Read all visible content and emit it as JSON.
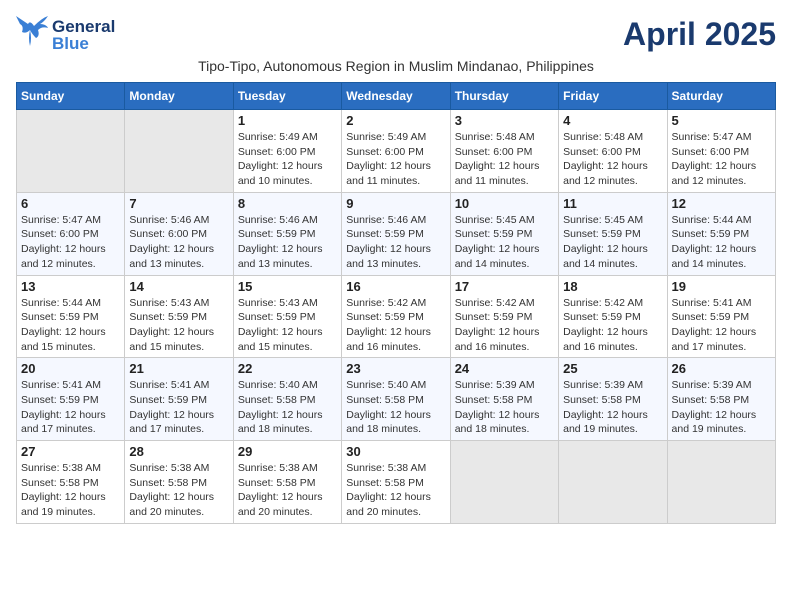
{
  "header": {
    "logo": {
      "general": "General",
      "blue": "Blue"
    },
    "title": "April 2025",
    "subtitle": "Tipo-Tipo, Autonomous Region in Muslim Mindanao, Philippines"
  },
  "weekdays": [
    "Sunday",
    "Monday",
    "Tuesday",
    "Wednesday",
    "Thursday",
    "Friday",
    "Saturday"
  ],
  "weeks": [
    [
      {
        "day": "",
        "info": ""
      },
      {
        "day": "",
        "info": ""
      },
      {
        "day": "1",
        "info": "Sunrise: 5:49 AM\nSunset: 6:00 PM\nDaylight: 12 hours\nand 10 minutes."
      },
      {
        "day": "2",
        "info": "Sunrise: 5:49 AM\nSunset: 6:00 PM\nDaylight: 12 hours\nand 11 minutes."
      },
      {
        "day": "3",
        "info": "Sunrise: 5:48 AM\nSunset: 6:00 PM\nDaylight: 12 hours\nand 11 minutes."
      },
      {
        "day": "4",
        "info": "Sunrise: 5:48 AM\nSunset: 6:00 PM\nDaylight: 12 hours\nand 12 minutes."
      },
      {
        "day": "5",
        "info": "Sunrise: 5:47 AM\nSunset: 6:00 PM\nDaylight: 12 hours\nand 12 minutes."
      }
    ],
    [
      {
        "day": "6",
        "info": "Sunrise: 5:47 AM\nSunset: 6:00 PM\nDaylight: 12 hours\nand 12 minutes."
      },
      {
        "day": "7",
        "info": "Sunrise: 5:46 AM\nSunset: 6:00 PM\nDaylight: 12 hours\nand 13 minutes."
      },
      {
        "day": "8",
        "info": "Sunrise: 5:46 AM\nSunset: 5:59 PM\nDaylight: 12 hours\nand 13 minutes."
      },
      {
        "day": "9",
        "info": "Sunrise: 5:46 AM\nSunset: 5:59 PM\nDaylight: 12 hours\nand 13 minutes."
      },
      {
        "day": "10",
        "info": "Sunrise: 5:45 AM\nSunset: 5:59 PM\nDaylight: 12 hours\nand 14 minutes."
      },
      {
        "day": "11",
        "info": "Sunrise: 5:45 AM\nSunset: 5:59 PM\nDaylight: 12 hours\nand 14 minutes."
      },
      {
        "day": "12",
        "info": "Sunrise: 5:44 AM\nSunset: 5:59 PM\nDaylight: 12 hours\nand 14 minutes."
      }
    ],
    [
      {
        "day": "13",
        "info": "Sunrise: 5:44 AM\nSunset: 5:59 PM\nDaylight: 12 hours\nand 15 minutes."
      },
      {
        "day": "14",
        "info": "Sunrise: 5:43 AM\nSunset: 5:59 PM\nDaylight: 12 hours\nand 15 minutes."
      },
      {
        "day": "15",
        "info": "Sunrise: 5:43 AM\nSunset: 5:59 PM\nDaylight: 12 hours\nand 15 minutes."
      },
      {
        "day": "16",
        "info": "Sunrise: 5:42 AM\nSunset: 5:59 PM\nDaylight: 12 hours\nand 16 minutes."
      },
      {
        "day": "17",
        "info": "Sunrise: 5:42 AM\nSunset: 5:59 PM\nDaylight: 12 hours\nand 16 minutes."
      },
      {
        "day": "18",
        "info": "Sunrise: 5:42 AM\nSunset: 5:59 PM\nDaylight: 12 hours\nand 16 minutes."
      },
      {
        "day": "19",
        "info": "Sunrise: 5:41 AM\nSunset: 5:59 PM\nDaylight: 12 hours\nand 17 minutes."
      }
    ],
    [
      {
        "day": "20",
        "info": "Sunrise: 5:41 AM\nSunset: 5:59 PM\nDaylight: 12 hours\nand 17 minutes."
      },
      {
        "day": "21",
        "info": "Sunrise: 5:41 AM\nSunset: 5:59 PM\nDaylight: 12 hours\nand 17 minutes."
      },
      {
        "day": "22",
        "info": "Sunrise: 5:40 AM\nSunset: 5:58 PM\nDaylight: 12 hours\nand 18 minutes."
      },
      {
        "day": "23",
        "info": "Sunrise: 5:40 AM\nSunset: 5:58 PM\nDaylight: 12 hours\nand 18 minutes."
      },
      {
        "day": "24",
        "info": "Sunrise: 5:39 AM\nSunset: 5:58 PM\nDaylight: 12 hours\nand 18 minutes."
      },
      {
        "day": "25",
        "info": "Sunrise: 5:39 AM\nSunset: 5:58 PM\nDaylight: 12 hours\nand 19 minutes."
      },
      {
        "day": "26",
        "info": "Sunrise: 5:39 AM\nSunset: 5:58 PM\nDaylight: 12 hours\nand 19 minutes."
      }
    ],
    [
      {
        "day": "27",
        "info": "Sunrise: 5:38 AM\nSunset: 5:58 PM\nDaylight: 12 hours\nand 19 minutes."
      },
      {
        "day": "28",
        "info": "Sunrise: 5:38 AM\nSunset: 5:58 PM\nDaylight: 12 hours\nand 20 minutes."
      },
      {
        "day": "29",
        "info": "Sunrise: 5:38 AM\nSunset: 5:58 PM\nDaylight: 12 hours\nand 20 minutes."
      },
      {
        "day": "30",
        "info": "Sunrise: 5:38 AM\nSunset: 5:58 PM\nDaylight: 12 hours\nand 20 minutes."
      },
      {
        "day": "",
        "info": ""
      },
      {
        "day": "",
        "info": ""
      },
      {
        "day": "",
        "info": ""
      }
    ]
  ]
}
